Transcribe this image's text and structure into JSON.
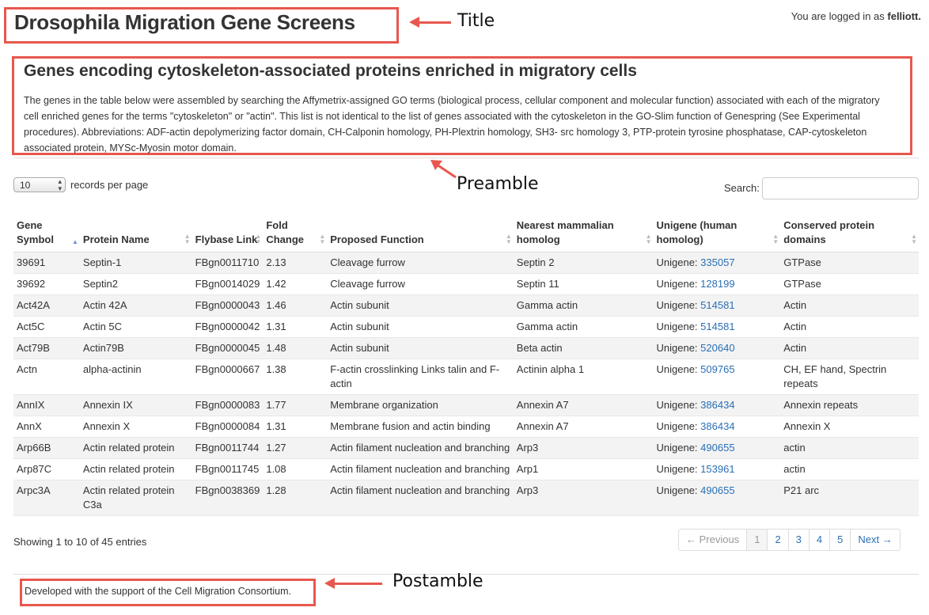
{
  "header": {
    "title": "Drosophila Migration Gene Screens",
    "login_prefix": "You are logged in as",
    "user": "felliott."
  },
  "annotations": {
    "title": "Title",
    "preamble": "Preamble",
    "postamble": "Postamble",
    "color": "#e8574e"
  },
  "preamble": {
    "heading": "Genes encoding cytoskeleton-associated proteins enriched in migratory cells",
    "text": "The genes in the table below were assembled by searching the Affymetrix-assigned GO terms (biological process, cellular component and molecular function) associated with each of the migratory cell enriched genes for the terms \"cytoskeleton\" or \"actin\". This list is not identical to the list of genes associated with the cytoskeleton in the GO-Slim function of Genespring (See Experimental procedures). Abbreviations: ADF-actin depolymerizing factor domain, CH-Calponin homology, PH-Plextrin homology, SH3- src homology 3, PTP-protein tyrosine phosphatase, CAP-cytoskeleton associated protein, MYSc-Myosin motor domain."
  },
  "controls": {
    "page_length": "10",
    "records_label": "records per page",
    "search_label": "Search:",
    "search_value": ""
  },
  "table": {
    "columns": [
      "Gene Symbol",
      "Protein Name",
      "Flybase Link",
      "Fold Change",
      "Proposed Function",
      "Nearest mammalian homolog",
      "Unigene (human homolog)",
      "Conserved protein domains"
    ],
    "unigene_prefix": "Unigene:",
    "rows": [
      [
        "39691",
        "Septin-1",
        "FBgn0011710",
        "2.13",
        "Cleavage furrow",
        "Septin 2",
        "335057",
        "GTPase"
      ],
      [
        "39692",
        "Septin2",
        "FBgn0014029",
        "1.42",
        "Cleavage furrow",
        "Septin 11",
        "128199",
        "GTPase"
      ],
      [
        "Act42A",
        "Actin 42A",
        "FBgn0000043",
        "1.46",
        "Actin subunit",
        "Gamma actin",
        "514581",
        "Actin"
      ],
      [
        "Act5C",
        "Actin 5C",
        "FBgn0000042",
        "1.31",
        "Actin subunit",
        "Gamma actin",
        "514581",
        "Actin"
      ],
      [
        "Act79B",
        "Actin79B",
        "FBgn0000045",
        "1.48",
        "Actin subunit",
        "Beta actin",
        "520640",
        "Actin"
      ],
      [
        "Actn",
        "alpha-actinin",
        "FBgn0000667",
        "1.38",
        "F-actin crosslinking Links talin and F-actin",
        "Actinin alpha 1",
        "509765",
        "CH, EF hand, Spectrin repeats"
      ],
      [
        "AnnIX",
        "Annexin IX",
        "FBgn0000083",
        "1.77",
        "Membrane organization",
        "Annexin A7",
        "386434",
        "Annexin repeats"
      ],
      [
        "AnnX",
        "Annexin X",
        "FBgn0000084",
        "1.31",
        "Membrane fusion and actin binding",
        "Annexin A7",
        "386434",
        "Annexin X"
      ],
      [
        "Arp66B",
        "Actin related protein",
        "FBgn0011744",
        "1.27",
        "Actin filament nucleation and branching",
        "Arp3",
        "490655",
        "actin"
      ],
      [
        "Arp87C",
        "Actin related protein",
        "FBgn0011745",
        "1.08",
        "Actin filament nucleation and branching",
        "Arp1",
        "153961",
        "actin"
      ],
      [
        "Arpc3A",
        "Actin related protein C3a",
        "FBgn0038369",
        "1.28",
        "Actin filament nucleation and branching",
        "Arp3",
        "490655",
        "P21 arc"
      ]
    ]
  },
  "footer": {
    "showing": "Showing 1 to 10 of 45 entries",
    "prev": "← Previous",
    "pages": [
      "1",
      "2",
      "3",
      "4",
      "5"
    ],
    "active_page": "1",
    "next": "Next →",
    "postamble": "Developed with the support of the Cell Migration Consortium."
  }
}
